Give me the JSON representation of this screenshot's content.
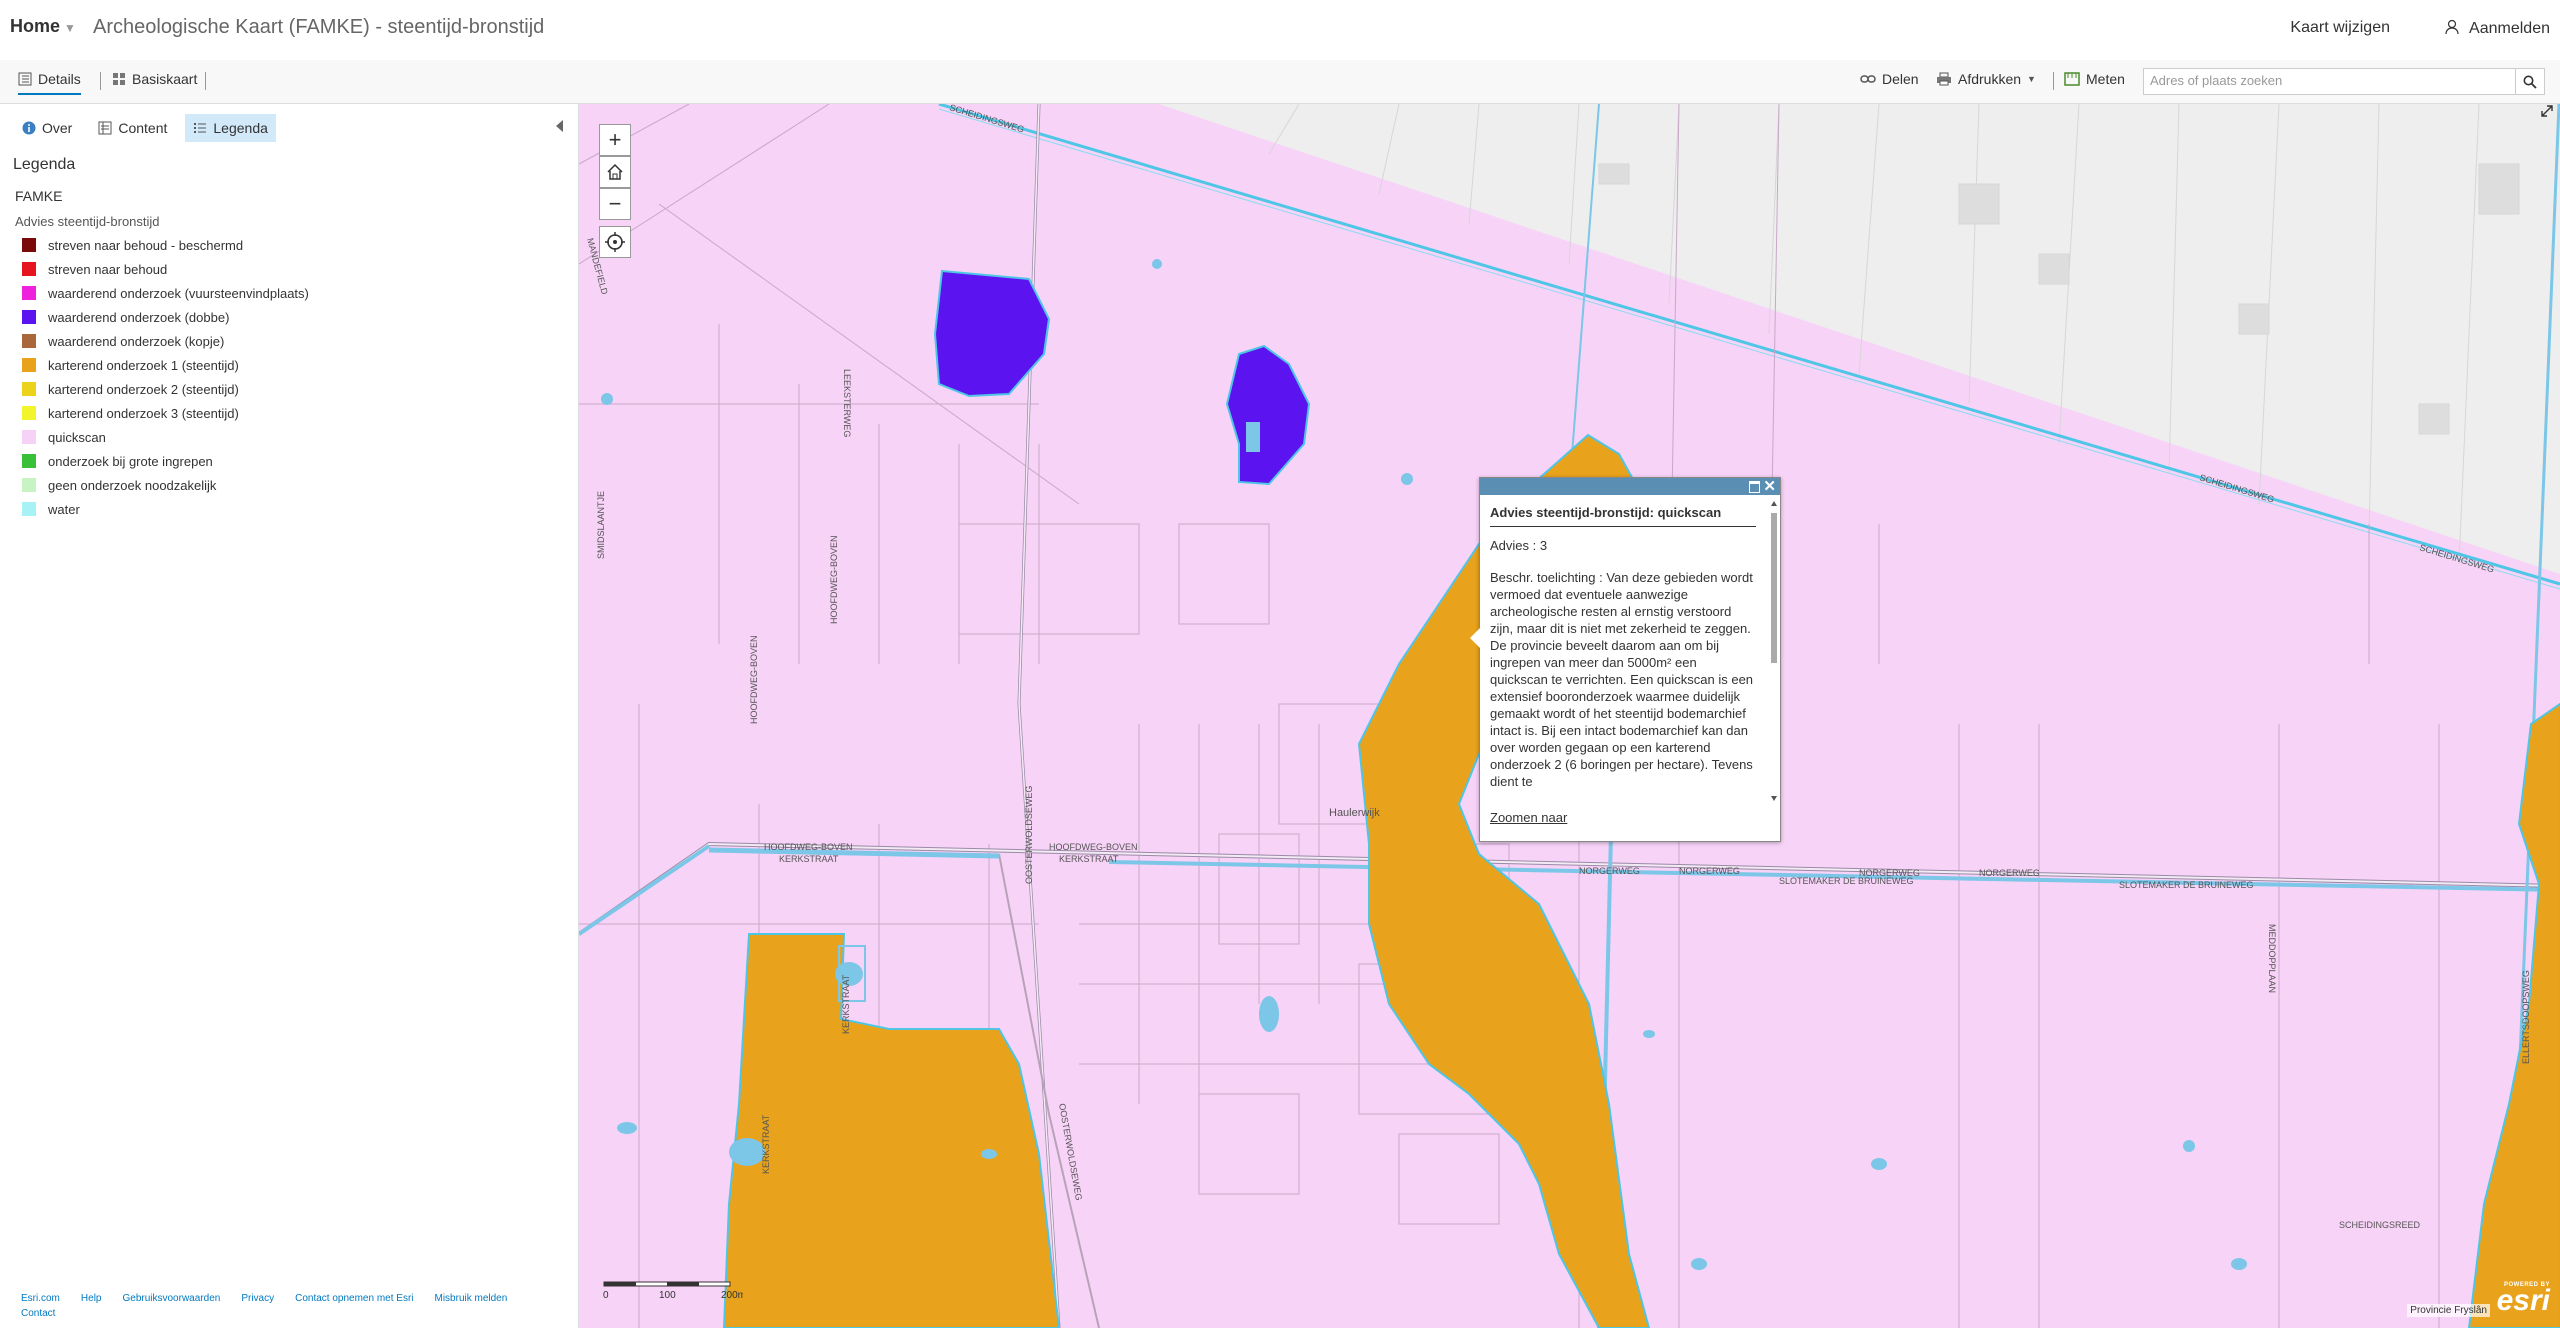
{
  "header": {
    "home_label": "Home",
    "title": "Archeologische Kaart (FAMKE) - steentijd-bronstijd",
    "modify_map": "Kaart wijzigen",
    "sign_in": "Aanmelden"
  },
  "toolbar": {
    "details_label": "Details",
    "basemap_label": "Basiskaart",
    "share_label": "Delen",
    "print_label": "Afdrukken",
    "measure_label": "Meten",
    "search_placeholder": "Adres of plaats zoeken"
  },
  "sidebar": {
    "tabs": [
      {
        "label": "Over"
      },
      {
        "label": "Content"
      },
      {
        "label": "Legenda"
      }
    ],
    "legend_heading": "Legenda",
    "layer_title": "FAMKE",
    "field_name": "Advies steentijd-bronstijd",
    "legend_items": [
      {
        "label": "streven naar behoud - beschermd",
        "color": "#7a0a0a"
      },
      {
        "label": "streven naar behoud",
        "color": "#e6141e"
      },
      {
        "label": "waarderend onderzoek (vuursteenvindplaats)",
        "color": "#ee22dc"
      },
      {
        "label": "waarderend onderzoek (dobbe)",
        "color": "#5b14f0"
      },
      {
        "label": "waarderend onderzoek (kopje)",
        "color": "#a8683a"
      },
      {
        "label": "karterend onderzoek 1 (steentijd)",
        "color": "#e8a21c"
      },
      {
        "label": "karterend onderzoek 2 (steentijd)",
        "color": "#ecd21a"
      },
      {
        "label": "karterend onderzoek 3 (steentijd)",
        "color": "#f2f42c"
      },
      {
        "label": "quickscan",
        "color": "#f6d2f6"
      },
      {
        "label": "onderzoek bij grote ingrepen",
        "color": "#38c038"
      },
      {
        "label": "geen onderzoek noodzakelijk",
        "color": "#c8f4c4"
      },
      {
        "label": "water",
        "color": "#a6f2f4"
      }
    ],
    "footer_links": [
      "Esri.com",
      "Help",
      "Gebruiksvoorwaarden",
      "Privacy",
      "Contact opnemen met Esri",
      "Misbruik melden",
      "Contact"
    ]
  },
  "map": {
    "zoom_in": "+",
    "zoom_out": "−",
    "street_labels": [
      "SCHEIDINGSWEG",
      "SCHEIDINGSWEG",
      "SCHEIDINGSWEG",
      "LEEKSTERWEG",
      "HOOFDWEG-BOVEN",
      "HOOFDWEG-BOVEN",
      "KERKSTRAAT",
      "KERKSTRAAT",
      "NORGERWEG",
      "NORGERWEG",
      "NORGERWEG",
      "NORGERWEG",
      "SLOTEMAKER DE BRUINEWEG",
      "SLOTEMAKER DE BRUINEWEG",
      "OOSTERWOLDSEWEG",
      "OOSTERWOLDSEWEG",
      "MEDDOPPLAAN",
      "ELLERTSDOOPSWEG",
      "HOOFDWEG-BOVEN",
      "HOOFDWEG-BOVEN",
      "MANDEFIELD",
      "SMIDSLAANTJE",
      "KERKSTRAAT",
      "KERKSTRAAT",
      "SCHEIDINGSREED"
    ],
    "place_label": "Haulerwijk",
    "attribution": "Provincie Fryslân",
    "esri_powered": "POWERED BY",
    "esri_name": "esri",
    "scale": {
      "labels": [
        "0",
        "100",
        "200m"
      ]
    }
  },
  "popup": {
    "title": "Advies steentijd-bronstijd: quickscan",
    "advies": "Advies : 3",
    "description": "Beschr. toelichting : Van deze gebieden wordt vermoed dat eventuele aanwezige archeologische resten al ernstig verstoord zijn, maar dit is niet met zekerheid te zeggen. De provincie beveelt daarom aan om bij ingrepen van meer dan 5000m² een quickscan te verrichten. Een quickscan is een extensief booronderzoek waarmee duidelijk gemaakt wordt of het steentijd bodemarchief intact is. Bij een intact bodemarchief kan dan over worden gegaan op een karterend onderzoek 2 (6 boringen per hectare). Tevens dient te",
    "zoom_link": "Zoomen naar"
  }
}
